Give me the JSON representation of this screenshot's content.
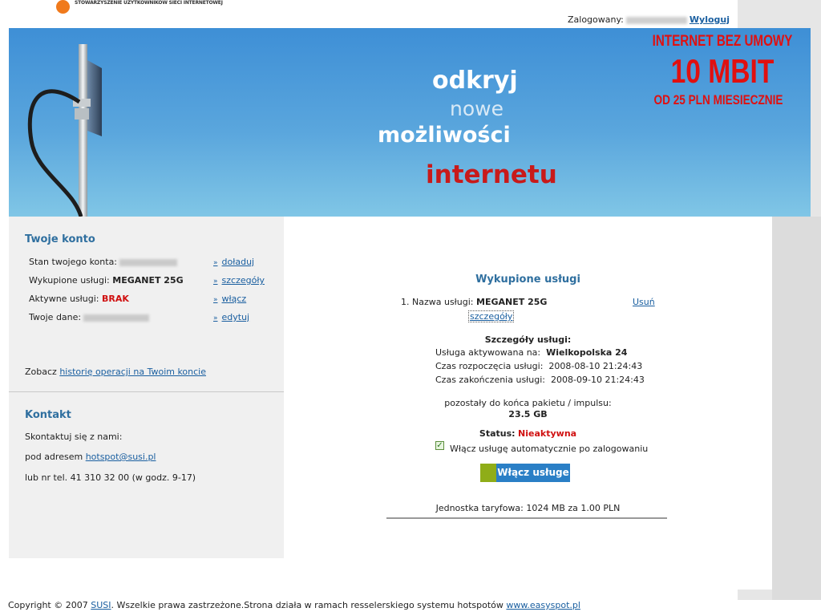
{
  "header": {
    "logo_text": "STOWARZYSZENIE UŻYTKOWNIKÓW SIECI INTERNETOWEJ",
    "logged_label": "Zalogowany:",
    "logout": "Wyloguj"
  },
  "banner": {
    "line1": "odkryj",
    "line2": "nowe",
    "line3": "możliwości",
    "line4": "internetu",
    "promo1": "INTERNET BEZ UMOWY",
    "promo2": "10 MBIT",
    "promo3": "OD 25 PLN MIESIECZNIE"
  },
  "account": {
    "title": "Twoje konto",
    "balance_label": "Stan twojego konta:",
    "balance_action": "doładuj",
    "services_label": "Wykupione usługi:",
    "services_value": "MEGANET 25G",
    "services_action": "szczegóły",
    "active_label": "Aktywne usługi:",
    "active_value": "BRAK",
    "active_action": "włącz",
    "data_label": "Twoje dane:",
    "data_action": "edytuj",
    "history_prefix": "Zobacz",
    "history_link": "historię operacji na Twoim koncie"
  },
  "contact": {
    "title": "Kontakt",
    "line1": "Skontaktuj się z nami:",
    "line2_prefix": "pod adresem",
    "email": "hotspot@susi.pl",
    "line3": "lub nr tel. 41 310 32 00 (w godz. 9-17)"
  },
  "main": {
    "title": "Wykupione usługi",
    "item_label": "1. Nazwa usługi:",
    "item_value": "MEGANET 25G",
    "item_details": "szczegóły",
    "item_remove": "Usuń",
    "details_title": "Szczegóły usługi:",
    "activated_label": "Usługa aktywowana na:",
    "activated_value": "Wielkopolska 24",
    "start_label": "Czas rozpoczęcia usługi:",
    "start_value": "2008-08-10 21:24:43",
    "end_label": "Czas zakończenia usługi:",
    "end_value": "2008-09-10 21:24:43",
    "remaining_label": "pozostały do końca pakietu / impulsu:",
    "remaining_value": "23.5 GB",
    "status_label": "Status:",
    "status_value": "Nieaktywna",
    "auto_label": "Włącz usługę automatycznie po zalogowaniu",
    "button": "Włącz usługe",
    "tariff": "Jednostka taryfowa: 1024 MB za 1.00 PLN"
  },
  "footer": {
    "copy_prefix": "Copyright © 2007",
    "susi": "SUSI",
    "copy_middle": ". Wszelkie prawa zastrzeżone.Strona działa w ramach resselerskiego systemu hotspotów",
    "easyspot": "www.easyspot.pl"
  },
  "colors": {
    "accent": "#2f6f9f",
    "promo_red": "#e01010",
    "status_red": "#d01010",
    "button_blue": "#2a7fc6",
    "button_green": "#8fad18"
  }
}
